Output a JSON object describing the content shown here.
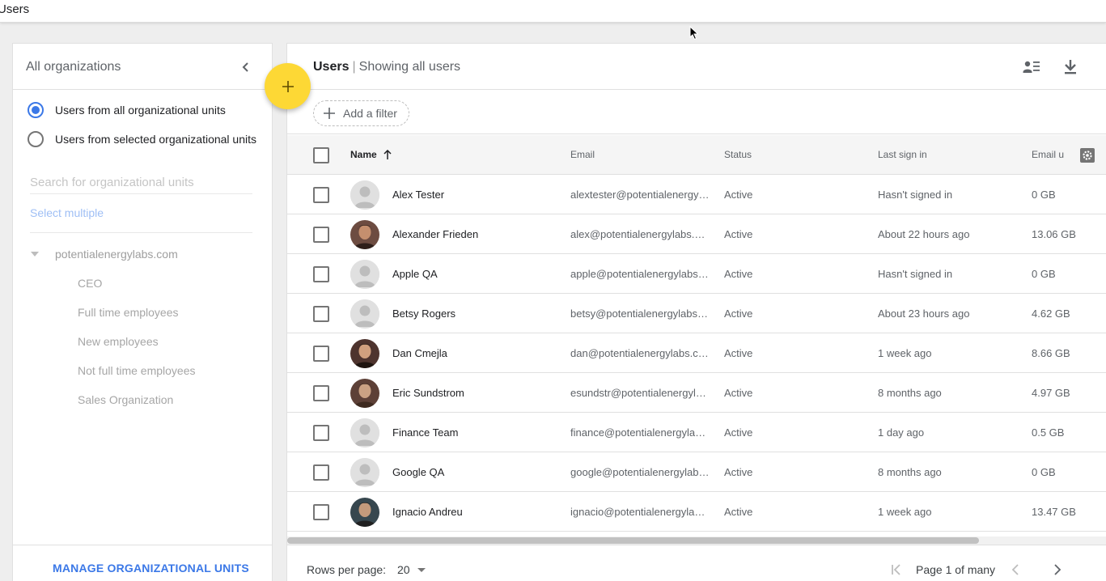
{
  "window": {
    "title": "Users"
  },
  "left_panel": {
    "title": "All organizations",
    "radio_options": [
      {
        "label": "Users from all organizational units",
        "checked": true
      },
      {
        "label": "Users from selected organizational units",
        "checked": false
      }
    ],
    "search_placeholder": "Search for organizational units",
    "select_multiple": "Select multiple",
    "tree": {
      "root": "potentialenergylabs.com",
      "children": [
        "CEO",
        "Full time employees",
        "New employees",
        "Not full time employees",
        "Sales Organization"
      ]
    },
    "footer_link": "MANAGE ORGANIZATIONAL UNITS"
  },
  "main": {
    "title": "Users",
    "separator": "|",
    "subtitle": "Showing all users",
    "add_filter": "Add a filter",
    "columns": {
      "name": "Name",
      "email": "Email",
      "status": "Status",
      "last_sign_in": "Last sign in",
      "email_usage": "Email u"
    },
    "rows": [
      {
        "name": "Alex Tester",
        "email": "alextester@potentialenergylabs.com",
        "status": "Active",
        "last_sign_in": "Hasn't signed in",
        "usage": "0 GB",
        "avatar": "generic"
      },
      {
        "name": "Alexander Frieden",
        "email": "alex@potentialenergylabs.com",
        "status": "Active",
        "last_sign_in": "About 22 hours ago",
        "usage": "13.06 GB",
        "avatar": "photo"
      },
      {
        "name": "Apple QA",
        "email": "apple@potentialenergylabs.com",
        "status": "Active",
        "last_sign_in": "Hasn't signed in",
        "usage": "0 GB",
        "avatar": "generic"
      },
      {
        "name": "Betsy Rogers",
        "email": "betsy@potentialenergylabs.com",
        "status": "Active",
        "last_sign_in": "About 23 hours ago",
        "usage": "4.62 GB",
        "avatar": "generic"
      },
      {
        "name": "Dan Cmejla",
        "email": "dan@potentialenergylabs.com",
        "status": "Active",
        "last_sign_in": "1 week ago",
        "usage": "8.66 GB",
        "avatar": "photo"
      },
      {
        "name": "Eric Sundstrom",
        "email": "esundstr@potentialenergylabs.com",
        "status": "Active",
        "last_sign_in": "8 months ago",
        "usage": "4.97 GB",
        "avatar": "photo"
      },
      {
        "name": "Finance Team",
        "email": "finance@potentialenergylabs.com",
        "status": "Active",
        "last_sign_in": "1 day ago",
        "usage": "0.5 GB",
        "avatar": "generic"
      },
      {
        "name": "Google QA",
        "email": "google@potentialenergylabs.com",
        "status": "Active",
        "last_sign_in": "8 months ago",
        "usage": "0 GB",
        "avatar": "generic"
      },
      {
        "name": "Ignacio Andreu",
        "email": "ignacio@potentialenergylabs.com",
        "status": "Active",
        "last_sign_in": "1 week ago",
        "usage": "13.47 GB",
        "avatar": "photo"
      }
    ],
    "pager": {
      "rows_label": "Rows per page:",
      "rows_value": "20",
      "page_info": "Page 1 of many"
    }
  },
  "colors": {
    "accent": "#3b78e7",
    "fab": "#fdd835"
  }
}
